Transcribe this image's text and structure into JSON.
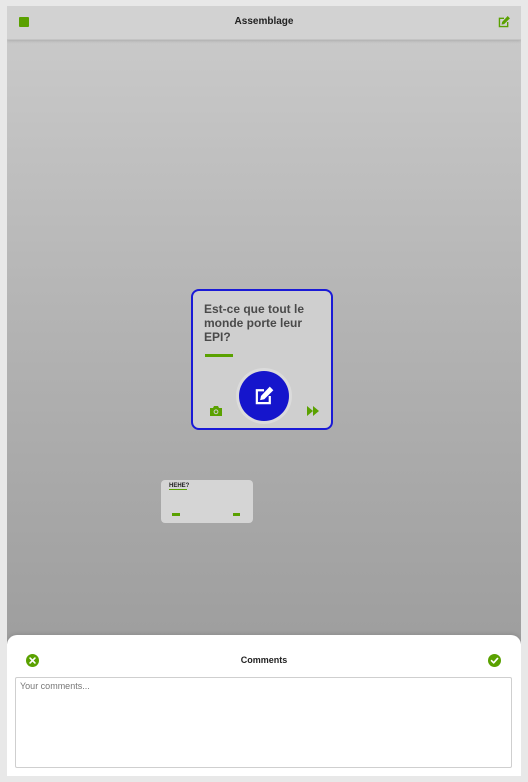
{
  "header": {
    "title": "Assemblage",
    "stop_icon": "stop-icon",
    "edit_icon": "edit-icon"
  },
  "card": {
    "question": "Est-ce que tout le monde porte leur EPI?",
    "camera_icon": "camera-icon",
    "edit_icon": "edit-icon",
    "next_icon": "fast-forward-icon"
  },
  "mini_card": {
    "text": "HEHE?"
  },
  "comments": {
    "title": "Comments",
    "placeholder": "Your comments...",
    "value": "",
    "cancel_icon": "close-circle-icon",
    "confirm_icon": "check-circle-icon"
  },
  "colors": {
    "accent_green": "#5aa100",
    "card_border_blue": "#1a1ad6",
    "edit_button_blue": "#1515cc",
    "topbar_gray": "#d2d2d2"
  }
}
